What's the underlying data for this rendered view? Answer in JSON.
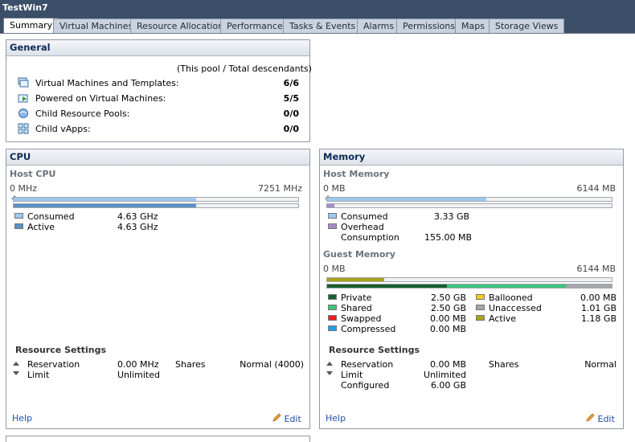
{
  "window": {
    "title": "TestWin7"
  },
  "tabs": [
    "Summary",
    "Virtual Machines",
    "Resource Allocation",
    "Performance",
    "Tasks & Events",
    "Alarms",
    "Permissions",
    "Maps",
    "Storage Views"
  ],
  "general": {
    "title": "General",
    "note": "(This pool / Total descendants)",
    "rows": [
      {
        "label": "Virtual Machines and Templates:",
        "value": "6/6",
        "icon": "vm-templates-icon"
      },
      {
        "label": "Powered on Virtual Machines:",
        "value": "5/5",
        "icon": "powered-on-vm-icon"
      },
      {
        "label": "Child Resource Pools:",
        "value": "0/0",
        "icon": "resource-pool-icon"
      },
      {
        "label": "Child vApps:",
        "value": "0/0",
        "icon": "vapp-icon"
      }
    ]
  },
  "cpu": {
    "title": "CPU",
    "host_label": "Host CPU",
    "min_label": "0 MHz",
    "max_label": "7251 MHz",
    "consumed_fraction": 0.64,
    "active_fraction": 0.64,
    "legend": [
      {
        "label": "Consumed",
        "value": "4.63 GHz",
        "color": "#9ec8f0"
      },
      {
        "label": "Active",
        "value": "4.63 GHz",
        "color": "#5c8fc8"
      }
    ],
    "resource_settings": {
      "title": "Resource Settings",
      "reservation_label": "Reservation",
      "reservation_value": "0.00 MHz",
      "limit_label": "Limit",
      "limit_value": "Unlimited",
      "shares_label": "Shares",
      "shares_value": "Normal (4000)"
    },
    "help": "Help",
    "edit": "Edit"
  },
  "memory": {
    "title": "Memory",
    "host_label": "Host Memory",
    "min_label": "0 MB",
    "max_label": "6144 MB",
    "consumed_fraction": 0.56,
    "overhead_fraction": 0.025,
    "legend": [
      {
        "label": "Consumed",
        "value": "3.33 GB",
        "color": "#9ec8f0"
      },
      {
        "label": "Overhead",
        "value": "",
        "color": "#a58bc7"
      },
      {
        "label": "Consumption",
        "value": "155.00 MB",
        "color": ""
      }
    ],
    "guest_label": "Guest Memory",
    "guest_min_label": "0 MB",
    "guest_max_label": "6144 MB",
    "guest_active_fraction": 0.2,
    "guest_private_fraction": 0.42,
    "guest_shared_fraction": 0.42,
    "guest_unaccessed_fraction": 0.16,
    "guest_left": [
      {
        "label": "Private",
        "value": "2.50 GB",
        "color": "#17602f"
      },
      {
        "label": "Shared",
        "value": "2.50 GB",
        "color": "#3dc47a"
      },
      {
        "label": "Swapped",
        "value": "0.00 MB",
        "color": "#ee1c1c"
      },
      {
        "label": "Compressed",
        "value": "0.00 MB",
        "color": "#22a0e8"
      }
    ],
    "guest_right": [
      {
        "label": "Ballooned",
        "value": "0.00 MB",
        "color": "#f2cc1a"
      },
      {
        "label": "Unaccessed",
        "value": "1.01 GB",
        "color": "#a6a6a6"
      },
      {
        "label": "Active",
        "value": "1.18 GB",
        "color": "#a8a41a"
      }
    ],
    "resource_settings": {
      "title": "Resource Settings",
      "reservation_label": "Reservation",
      "reservation_value": "0.00 MB",
      "limit_label": "Limit",
      "limit_value": "Unlimited",
      "configured_label": "Configured",
      "configured_value": "6.00 GB",
      "shares_label": "Shares",
      "shares_value": "Normal"
    },
    "help": "Help",
    "edit": "Edit"
  }
}
